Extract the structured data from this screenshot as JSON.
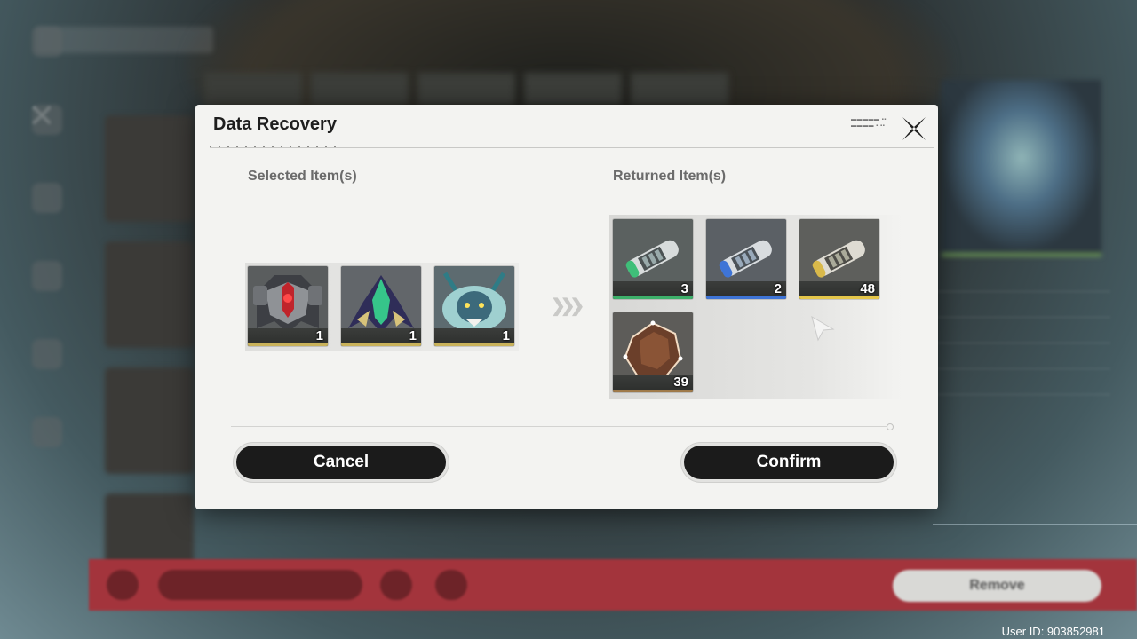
{
  "dialog": {
    "title": "Data Recovery",
    "close_icon": "close-x-icon",
    "selected_label": "Selected Item(s)",
    "returned_label": "Returned Item(s)",
    "selected_items": [
      {
        "icon": "echo-red-mech-icon",
        "qty": "1"
      },
      {
        "icon": "echo-green-crest-icon",
        "qty": "1"
      },
      {
        "icon": "echo-cyan-beast-icon",
        "qty": "1"
      }
    ],
    "returned_items": [
      {
        "icon": "tuner-green-canister-icon",
        "qty": "3",
        "rarity_color": "#3db06a"
      },
      {
        "icon": "tuner-blue-canister-icon",
        "qty": "2",
        "rarity_color": "#3e74d6"
      },
      {
        "icon": "tuner-gold-canister-icon",
        "qty": "48",
        "rarity_color": "#e4c64a"
      },
      {
        "icon": "bronze-crystal-icon",
        "qty": "39",
        "rarity_color": "#9f7a4a"
      }
    ],
    "cancel_label": "Cancel",
    "confirm_label": "Confirm"
  },
  "background": {
    "remove_label": "Remove",
    "user_id": "User ID: 903852981"
  },
  "colors": {
    "dialog_bg": "#f3f3f1",
    "button_bg": "#1b1b1b",
    "bottom_bar": "#a3343c"
  }
}
